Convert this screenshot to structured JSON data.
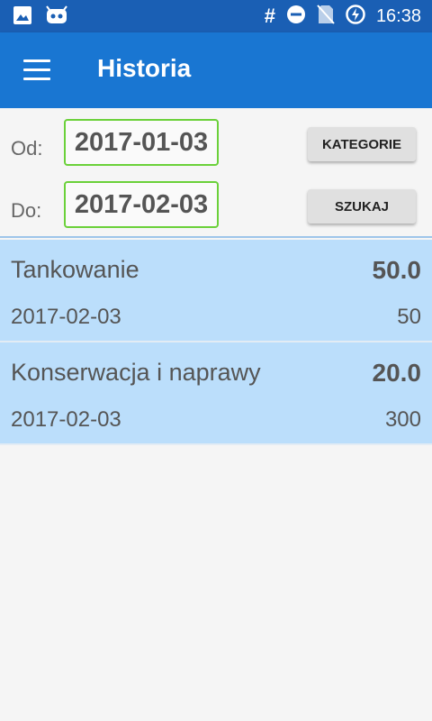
{
  "status_bar": {
    "time": "16:38",
    "icons": [
      "image-icon",
      "android-debug-icon",
      "hash-icon",
      "do-not-disturb-icon",
      "no-sim-icon",
      "battery-charging-icon"
    ]
  },
  "app_bar": {
    "title": "Historia",
    "menu_icon": "hamburger-menu-icon",
    "color": "#1976d2"
  },
  "filter": {
    "from_label": "Od:",
    "from_date": "2017-01-03",
    "to_label": "Do:",
    "to_date": "2017-02-03",
    "categories_button": "KATEGORIE",
    "search_button": "SZUKAJ"
  },
  "history": [
    {
      "name": "Tankowanie",
      "amount": "50.0",
      "date": "2017-02-03",
      "quantity": "50"
    },
    {
      "name": "Konserwacja i naprawy",
      "amount": "20.0",
      "date": "2017-02-03",
      "quantity": "300"
    }
  ],
  "colors": {
    "status_bar": "#1a5fb4",
    "item_background": "#bbdefb",
    "date_border": "#6bd13a"
  }
}
